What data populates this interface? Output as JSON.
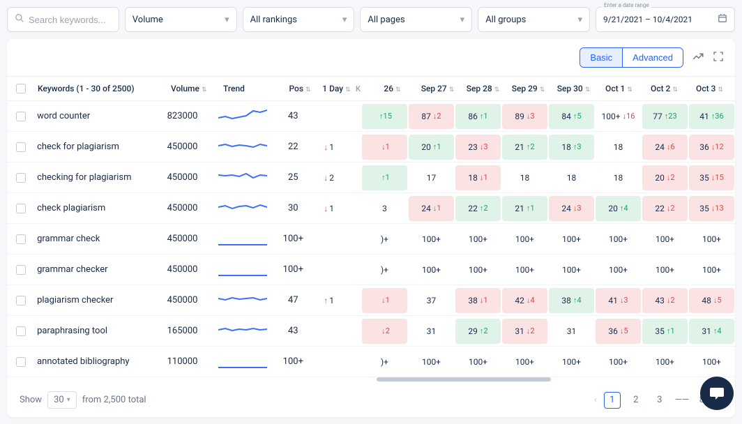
{
  "filters": {
    "search_placeholder": "Search keywords...",
    "volume": "Volume",
    "rankings": "All rankings",
    "pages": "All pages",
    "groups": "All groups",
    "date_label": "Enter a date range",
    "date_value": "9/21/2021 – 10/4/2021"
  },
  "modes": {
    "basic": "Basic",
    "advanced": "Advanced"
  },
  "headers": {
    "keywords": "Keywords (1 - 30 of 2500)",
    "volume": "Volume",
    "trend": "Trend",
    "pos": "Pos",
    "day": "1 Day",
    "k": "K"
  },
  "date_cols": [
    "26",
    "Sep 27",
    "Sep 28",
    "Sep 29",
    "Sep 30",
    "Oct 1",
    "Oct 2",
    "Oct 3"
  ],
  "rows": [
    {
      "keyword": "word counter",
      "volume": "823000",
      "pos": "43",
      "day": "",
      "cells": [
        {
          "r": "",
          "d": "↑15",
          "t": "g"
        },
        {
          "r": "87",
          "d": "↓2",
          "t": "r"
        },
        {
          "r": "86",
          "d": "↑1",
          "t": "g"
        },
        {
          "r": "89",
          "d": "↓3",
          "t": "r"
        },
        {
          "r": "84",
          "d": "↑5",
          "t": "g"
        },
        {
          "r": "100+",
          "d": "↓16",
          "t": "p"
        },
        {
          "r": "77",
          "d": "↑23",
          "t": "g"
        },
        {
          "r": "41",
          "d": "↑36",
          "t": "g"
        }
      ]
    },
    {
      "keyword": "check for plagiarism",
      "volume": "450000",
      "pos": "22",
      "day": "↓1",
      "cells": [
        {
          "r": "",
          "d": "↓1",
          "t": "r"
        },
        {
          "r": "20",
          "d": "↑1",
          "t": "g"
        },
        {
          "r": "23",
          "d": "↓3",
          "t": "r"
        },
        {
          "r": "21",
          "d": "↑2",
          "t": "g"
        },
        {
          "r": "18",
          "d": "↑3",
          "t": "g"
        },
        {
          "r": "18",
          "d": "",
          "t": "p"
        },
        {
          "r": "24",
          "d": "↓6",
          "t": "r"
        },
        {
          "r": "36",
          "d": "↓12",
          "t": "r"
        }
      ]
    },
    {
      "keyword": "checking for plagiarism",
      "volume": "450000",
      "pos": "25",
      "day": "↓2",
      "cells": [
        {
          "r": "",
          "d": "↑1",
          "t": "g"
        },
        {
          "r": "17",
          "d": "",
          "t": "p"
        },
        {
          "r": "18",
          "d": "↓1",
          "t": "r"
        },
        {
          "r": "18",
          "d": "",
          "t": "p"
        },
        {
          "r": "18",
          "d": "",
          "t": "p"
        },
        {
          "r": "18",
          "d": "",
          "t": "p"
        },
        {
          "r": "20",
          "d": "↓2",
          "t": "r"
        },
        {
          "r": "35",
          "d": "↓15",
          "t": "r"
        }
      ]
    },
    {
      "keyword": "check plagiarism",
      "volume": "450000",
      "pos": "30",
      "day": "↓1",
      "cells": [
        {
          "r": "3",
          "d": "",
          "t": "p"
        },
        {
          "r": "24",
          "d": "↓1",
          "t": "r"
        },
        {
          "r": "22",
          "d": "↑2",
          "t": "g"
        },
        {
          "r": "21",
          "d": "↑1",
          "t": "g"
        },
        {
          "r": "24",
          "d": "↓3",
          "t": "r"
        },
        {
          "r": "20",
          "d": "↑4",
          "t": "g"
        },
        {
          "r": "22",
          "d": "↓2",
          "t": "r"
        },
        {
          "r": "35",
          "d": "↓13",
          "t": "r"
        }
      ]
    },
    {
      "keyword": "grammar check",
      "volume": "450000",
      "pos": "100+",
      "day": "",
      "cells": [
        {
          "r": ")+",
          "d": "",
          "t": "p"
        },
        {
          "r": "100+",
          "d": "",
          "t": "p"
        },
        {
          "r": "100+",
          "d": "",
          "t": "p"
        },
        {
          "r": "100+",
          "d": "",
          "t": "p"
        },
        {
          "r": "100+",
          "d": "",
          "t": "p"
        },
        {
          "r": "100+",
          "d": "",
          "t": "p"
        },
        {
          "r": "100+",
          "d": "",
          "t": "p"
        },
        {
          "r": "100+",
          "d": "",
          "t": "p"
        }
      ]
    },
    {
      "keyword": "grammar checker",
      "volume": "450000",
      "pos": "100+",
      "day": "",
      "cells": [
        {
          "r": ")+",
          "d": "",
          "t": "p"
        },
        {
          "r": "100+",
          "d": "",
          "t": "p"
        },
        {
          "r": "100+",
          "d": "",
          "t": "p"
        },
        {
          "r": "100+",
          "d": "",
          "t": "p"
        },
        {
          "r": "100+",
          "d": "",
          "t": "p"
        },
        {
          "r": "100+",
          "d": "",
          "t": "p"
        },
        {
          "r": "100+",
          "d": "",
          "t": "p"
        },
        {
          "r": "100+",
          "d": "",
          "t": "p"
        }
      ]
    },
    {
      "keyword": "plagiarism checker",
      "volume": "450000",
      "pos": "47",
      "day": "↑1",
      "cells": [
        {
          "r": "",
          "d": "↓1",
          "t": "r"
        },
        {
          "r": "37",
          "d": "",
          "t": "p"
        },
        {
          "r": "38",
          "d": "↓1",
          "t": "r"
        },
        {
          "r": "42",
          "d": "↓4",
          "t": "r"
        },
        {
          "r": "38",
          "d": "↑4",
          "t": "g"
        },
        {
          "r": "41",
          "d": "↓3",
          "t": "r"
        },
        {
          "r": "43",
          "d": "↓2",
          "t": "r"
        },
        {
          "r": "48",
          "d": "↓5",
          "t": "r"
        }
      ]
    },
    {
      "keyword": "paraphrasing tool",
      "volume": "165000",
      "pos": "43",
      "day": "",
      "cells": [
        {
          "r": "",
          "d": "↓2",
          "t": "r"
        },
        {
          "r": "31",
          "d": "",
          "t": "p"
        },
        {
          "r": "29",
          "d": "↑2",
          "t": "g"
        },
        {
          "r": "31",
          "d": "↓2",
          "t": "r"
        },
        {
          "r": "31",
          "d": "",
          "t": "p"
        },
        {
          "r": "36",
          "d": "↓5",
          "t": "r"
        },
        {
          "r": "35",
          "d": "↑1",
          "t": "g"
        },
        {
          "r": "31",
          "d": "↑4",
          "t": "g"
        }
      ]
    },
    {
      "keyword": "annotated bibliography",
      "volume": "110000",
      "pos": "100+",
      "day": "",
      "cells": [
        {
          "r": ")+",
          "d": "",
          "t": "p"
        },
        {
          "r": "100+",
          "d": "",
          "t": "p"
        },
        {
          "r": "100+",
          "d": "",
          "t": "p"
        },
        {
          "r": "100+",
          "d": "",
          "t": "p"
        },
        {
          "r": "100+",
          "d": "",
          "t": "p"
        },
        {
          "r": "100+",
          "d": "",
          "t": "p"
        },
        {
          "r": "100+",
          "d": "",
          "t": "p"
        },
        {
          "r": "100+",
          "d": "",
          "t": "p"
        }
      ]
    }
  ],
  "footer": {
    "show": "Show",
    "per_page": "30",
    "from_total": "from 2,500 total",
    "pages": [
      "1",
      "2",
      "3"
    ],
    "ellipsis": "——",
    "last": "84"
  },
  "trends": [
    "M0,16 L10,14 L20,17 L30,15 L40,13 L50,6 L60,8 L70,5",
    "M0,12 L10,10 L20,13 L30,11 L40,12 L50,14 L60,10 L70,12",
    "M0,10 L10,11 L20,10 L30,12 L40,8 L50,14 L60,10 L70,11",
    "M0,12 L10,10 L20,14 L30,11 L40,10 L50,13 L60,9 L70,12",
    "M0,22 L70,22",
    "M0,22 L70,22",
    "M0,11 L10,13 L20,10 L30,12 L40,11 L50,10 L60,13 L70,11",
    "M0,12 L10,10 L20,13 L30,11 L40,12 L50,10 L60,12 L70,11",
    "M0,22 L70,22"
  ]
}
